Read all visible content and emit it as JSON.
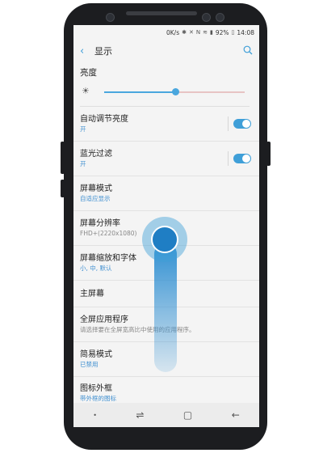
{
  "status_bar": {
    "net_speed": "0K/s",
    "battery": "92%",
    "time": "14:08"
  },
  "header": {
    "title": "显示"
  },
  "brightness": {
    "label": "亮度",
    "level_percent": 51
  },
  "settings": [
    {
      "title": "自动调节亮度",
      "subtitle": "开",
      "toggle": true
    },
    {
      "title": "蓝光过滤",
      "subtitle": "开",
      "toggle": true
    },
    {
      "title": "屏幕模式",
      "subtitle": "自适应显示"
    },
    {
      "title": "屏幕分辨率",
      "subtitle": "FHD+(2220x1080)",
      "sub_style": "grey"
    },
    {
      "title": "屏幕缩放和字体",
      "subtitle": "小, 中, 默认"
    },
    {
      "title": "主屏幕",
      "subtitle": ""
    },
    {
      "title": "全屏应用程序",
      "subtitle": "请选择要在全屏宽高比中使用的应用程序。",
      "sub_style": "grey"
    },
    {
      "title": "简易模式",
      "subtitle": "已禁用"
    },
    {
      "title": "图标外框",
      "subtitle": "带外框的图标"
    }
  ],
  "colors": {
    "accent": "#3f9fd8",
    "background": "#f4f4f4"
  },
  "icons": {
    "back": "chevron-left-icon",
    "search": "search-icon",
    "brightness": "sun-icon"
  }
}
